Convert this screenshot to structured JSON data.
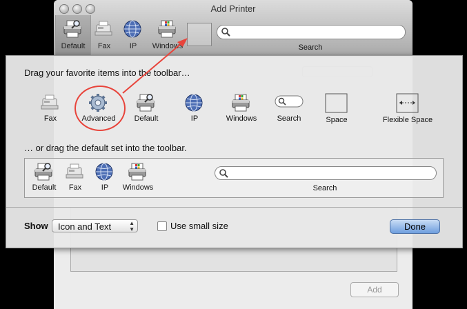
{
  "window": {
    "title": "Add Printer",
    "toolbar": [
      {
        "label": "Default",
        "icon": "printer-search-icon"
      },
      {
        "label": "Fax",
        "icon": "fax-icon"
      },
      {
        "label": "IP",
        "icon": "globe-icon"
      },
      {
        "label": "Windows",
        "icon": "printer-windows-icon"
      }
    ],
    "search_label": "Search",
    "add_button": "Add"
  },
  "sheet": {
    "favorites_heading": "Drag your favorite items into the toolbar…",
    "palette": [
      {
        "label": "Fax",
        "icon": "fax-icon"
      },
      {
        "label": "Advanced",
        "icon": "gear-icon"
      },
      {
        "label": "Default",
        "icon": "printer-search-icon"
      },
      {
        "label": "IP",
        "icon": "globe-icon"
      },
      {
        "label": "Windows",
        "icon": "printer-windows-icon"
      },
      {
        "label": "Search",
        "icon": "search-field-icon"
      },
      {
        "label": "Space",
        "icon": "space-icon"
      },
      {
        "label": "Flexible Space",
        "icon": "flexible-space-icon"
      }
    ],
    "default_heading": "… or drag the default set into the toolbar.",
    "default_set": [
      {
        "label": "Default",
        "icon": "printer-search-icon"
      },
      {
        "label": "Fax",
        "icon": "fax-icon"
      },
      {
        "label": "IP",
        "icon": "globe-icon"
      },
      {
        "label": "Windows",
        "icon": "printer-windows-icon"
      }
    ],
    "default_search_label": "Search",
    "show_label": "Show",
    "show_value": "Icon and Text",
    "small_size_label": "Use small size",
    "small_size_checked": false,
    "done_button": "Done"
  },
  "colors": {
    "highlight": "#e8443b",
    "done_button": "#6f9ede"
  }
}
